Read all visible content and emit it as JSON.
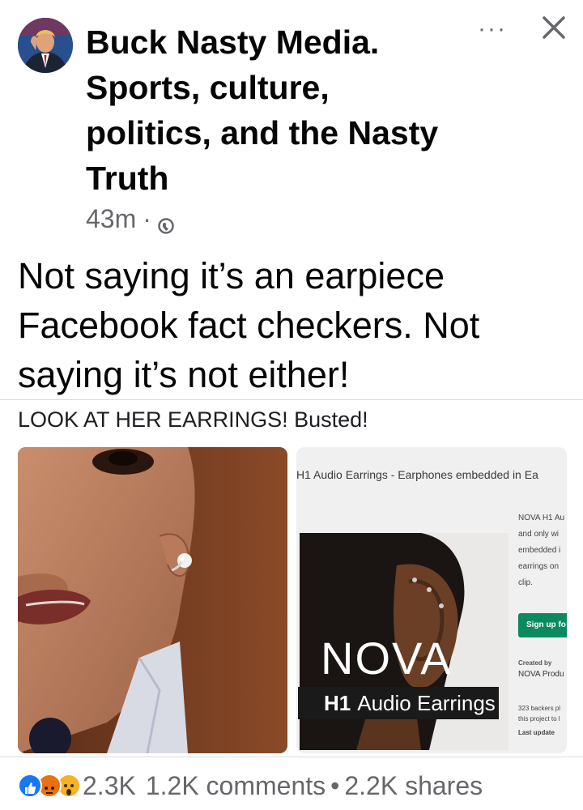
{
  "post": {
    "author": "Buck Nasty Media. Sports, culture, politics, and the Nasty Truth",
    "time": "43m",
    "separator": "·",
    "more_label": "···",
    "text": "Not saying it’s an earpiece Facebook fact checkers. Not saying it’s not either!",
    "caption": "LOOK AT HER EARRINGS! Busted!"
  },
  "screenshot": {
    "title": "H1 Audio Earrings - Earphones embedded in Ea",
    "description": "NOVA H1 Au\nand only wi\nembedded i\nearrings on\nclip.",
    "signup": "Sign up fo",
    "created_by": "Created by",
    "creator": "NOVA Produ",
    "backers": "323 backers pl this project to l",
    "last_updated": "Last update",
    "logo": "NOVA",
    "product_bold": "H1",
    "product_name": "Audio Earrings"
  },
  "footer": {
    "reactions_count": "2.3K",
    "comments": "1.2K comments",
    "dot": "•",
    "shares": "2.2K shares"
  },
  "icons": [
    "globe-icon",
    "more-icon",
    "close-icon",
    "like-icon",
    "angry-icon",
    "wow-icon"
  ],
  "colors": {
    "secondary_text": "#65676b",
    "like_blue": "#1877f2",
    "angry_orange": "#e9710f",
    "wow_yellow": "#f7b125"
  }
}
